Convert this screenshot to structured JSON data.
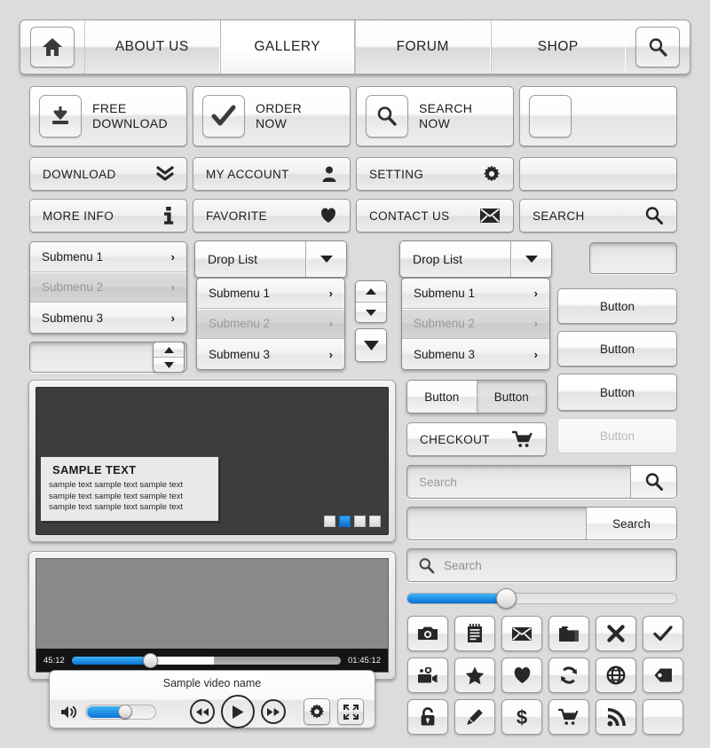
{
  "nav": {
    "home_icon": "home-icon",
    "search_icon": "search-icon",
    "items": [
      {
        "label": "ABOUT US",
        "active": false
      },
      {
        "label": "GALLERY",
        "active": true
      },
      {
        "label": "FORUM",
        "active": false
      },
      {
        "label": "SHOP",
        "active": false
      }
    ]
  },
  "icon_buttons": [
    {
      "line1": "FREE",
      "line2": "DOWNLOAD",
      "icon": "download-icon"
    },
    {
      "line1": "ORDER",
      "line2": "NOW",
      "icon": "check-icon"
    },
    {
      "line1": "SEARCH",
      "line2": "NOW",
      "icon": "search-icon"
    },
    {
      "line1": "",
      "line2": "",
      "icon": "blank-icon"
    }
  ],
  "bar_buttons": [
    {
      "label": "DOWNLOAD",
      "icon": "double-chevron-down-icon"
    },
    {
      "label": "MY ACCOUNT",
      "icon": "user-icon"
    },
    {
      "label": "SETTING",
      "icon": "gear-icon"
    },
    {
      "label": "",
      "icon": "none"
    },
    {
      "label": "MORE INFO",
      "icon": "info-icon"
    },
    {
      "label": "FAVORITE",
      "icon": "heart-icon"
    },
    {
      "label": "CONTACT US",
      "icon": "envelope-icon"
    },
    {
      "label": "SEARCH",
      "icon": "search-icon"
    }
  ],
  "submenu": {
    "items": [
      {
        "label": "Submenu 1",
        "state": "normal"
      },
      {
        "label": "Submenu 2",
        "state": "disabled"
      },
      {
        "label": "Submenu 3",
        "state": "normal"
      }
    ],
    "chevron": "›"
  },
  "droplist": {
    "label": "Drop List",
    "arrow_icon": "chevron-down-icon"
  },
  "spinner": {
    "up_icon": "caret-up-icon",
    "down_icon": "caret-down-icon"
  },
  "banner": {
    "heading": "SAMPLE TEXT",
    "lines": [
      "sample text sample text sample text",
      "sample text sample text sample text",
      "sample text sample text sample text"
    ],
    "dots": 4,
    "active_dot": 2,
    "active_color": "#1b8ee8"
  },
  "video": {
    "current_time": "45:12",
    "total_time": "01:45:12",
    "progress_percent": 28,
    "buffered_percent": 53,
    "name": "Sample video name",
    "volume_percent": 50,
    "volume_icon": "speaker-icon",
    "rewind_icon": "rewind-icon",
    "play_icon": "play-icon",
    "forward_icon": "fast-forward-icon",
    "settings_icon": "gear-icon",
    "fullscreen_icon": "fullscreen-icon"
  },
  "right_column": {
    "segmented": [
      {
        "label": "Button",
        "pressed": false
      },
      {
        "label": "Button",
        "pressed": true
      }
    ],
    "checkout": {
      "label": "CHECKOUT",
      "icon": "cart-icon"
    },
    "buttons": [
      {
        "label": "",
        "disabled": false
      },
      {
        "label": "Button",
        "disabled": false
      },
      {
        "label": "Button",
        "disabled": false
      },
      {
        "label": "Button",
        "disabled": false
      },
      {
        "label": "Button",
        "disabled": true
      }
    ],
    "search_icon_field": {
      "placeholder": "Search",
      "icon": "search-icon"
    },
    "search_button_field": {
      "placeholder": "",
      "button_label": "Search"
    },
    "search_inline": {
      "placeholder": "Search",
      "icon": "search-icon"
    },
    "slider": {
      "value_percent": 36
    }
  },
  "icon_grid": [
    "camera-icon",
    "notepad-icon",
    "envelope-icon",
    "folder-icon",
    "close-icon",
    "check-icon",
    "video-camera-icon",
    "star-icon",
    "heart-icon",
    "refresh-icon",
    "globe-icon",
    "tag-icon",
    "lock-icon",
    "pencil-icon",
    "dollar-icon",
    "cart-icon",
    "rss-icon",
    "blank-icon"
  ]
}
